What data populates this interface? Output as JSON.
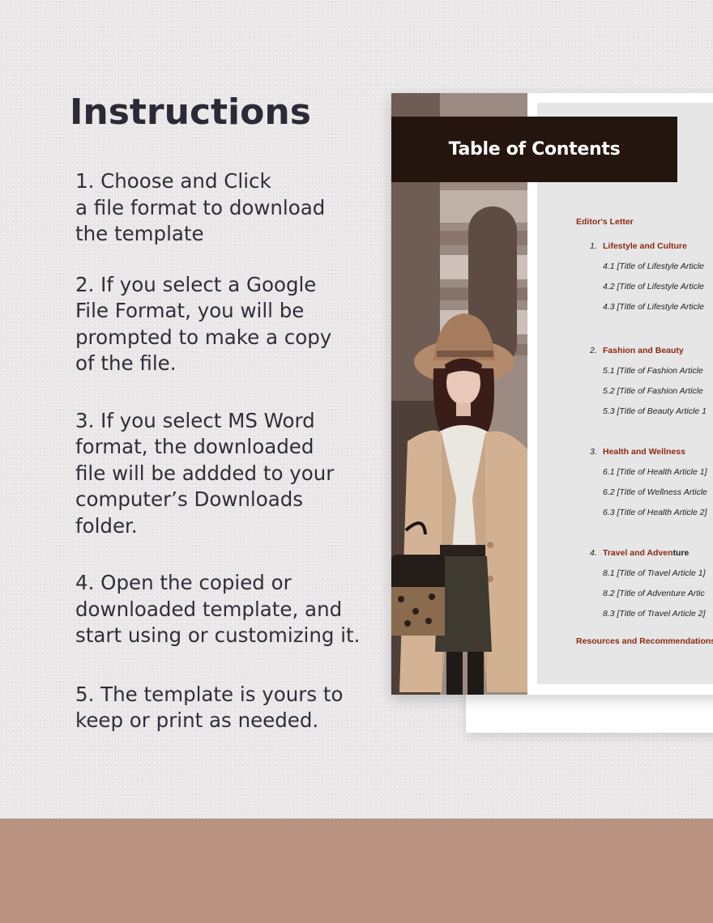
{
  "heading": "Instructions",
  "steps": [
    "1. Choose and Click\na file format to download\nthe template",
    "2. If you select a Google\nFile Format, you will be\nprompted to make a copy\nof the file.",
    "3. If you select MS Word\nformat, the downloaded\nfile will be addded to your\ncomputer’s Downloads\nfolder.",
    "4. Open the copied or\ndownloaded template, and\nstart using or customizing it.",
    "5. The template is yours to\nkeep or print as needed."
  ],
  "preview": {
    "title": "Table of Contents",
    "editors_letter": "Editor's Letter",
    "sections": [
      {
        "num": "1.",
        "title": "Lifestyle and Culture",
        "items": [
          "4.1 [Title of Lifestyle Article",
          "4.2 [Title of Lifestyle Article",
          "4.3 [Title of Lifestyle Article"
        ]
      },
      {
        "num": "2.",
        "title": "Fashion and Beauty",
        "items": [
          "5.1 [Title of Fashion Article",
          "5.2 [Title of Fashion Article",
          "5.3 [Title of Beauty Article 1"
        ]
      },
      {
        "num": "3.",
        "title": "Health and Wellness",
        "items": [
          "6.1 [Title of Health Article 1]",
          "6.2 [Title of Wellness Article",
          "6.3 [Title of Health Article 2]"
        ]
      },
      {
        "num": "4.",
        "title_a": "Travel and Adven",
        "title_b": "ture",
        "items": [
          "8.1 [Title of Travel Article 1]",
          "8.2 [Title of Adventure Artic",
          "8.3 [Title of Travel Article 2]"
        ]
      }
    ],
    "resources": "Resources and Recommendations"
  },
  "colors": {
    "background": "#ebe8ea",
    "heading_text": "#2b2b37",
    "title_bar": "#24150f",
    "accent_section": "#8c2a12",
    "footer_band": "#b9937f"
  }
}
